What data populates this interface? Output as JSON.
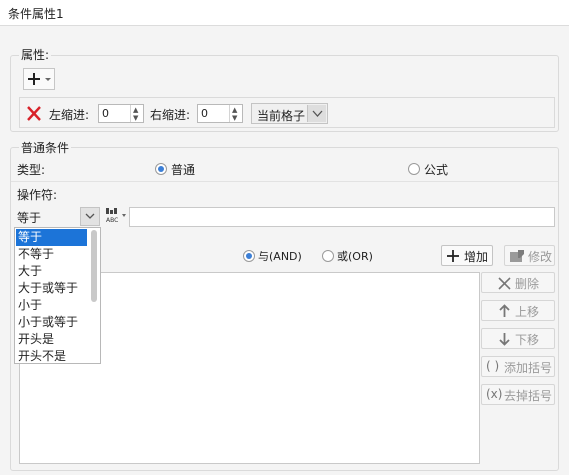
{
  "window": {
    "title": "条件属性1"
  },
  "attributes": {
    "legend": "属性:",
    "add_icon": "plus-dropdown-icon",
    "delete_icon": "red-x-icon",
    "left_indent_label": "左缩进:",
    "left_indent_value": "0",
    "right_indent_label": "右缩进:",
    "right_indent_value": "0",
    "scope_value": "当前格子"
  },
  "condition": {
    "legend": "普通条件",
    "type_label": "类型:",
    "type_normal": "普通",
    "type_formula": "公式",
    "operator_label": "操作符:",
    "operator_selected": "等于",
    "operator_options": [
      "等于",
      "不等于",
      "大于",
      "大于或等于",
      "小于",
      "小于或等于",
      "开头是",
      "开头不是"
    ],
    "value_input": "",
    "and_label": "与(AND)",
    "or_label": "或(OR)"
  },
  "buttons": {
    "add": "增加",
    "modify": "修改",
    "delete": "删除",
    "move_up": "上移",
    "move_down": "下移",
    "add_bracket": "添加括号",
    "remove_bracket": "去掉括号"
  },
  "colors": {
    "accent": "#1c74d8",
    "delete_red": "#d8222a"
  }
}
